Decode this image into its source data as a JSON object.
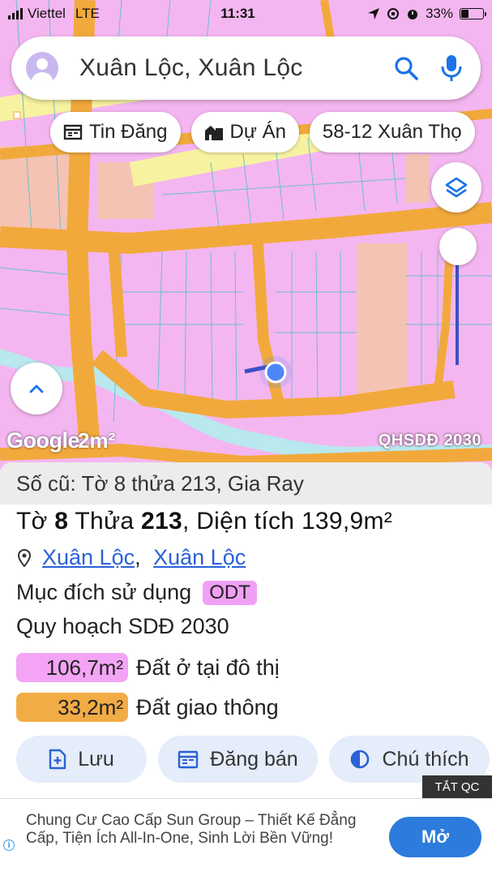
{
  "status_bar": {
    "carrier": "Viettel",
    "network": "LTE",
    "time": "11:31",
    "battery": "33%",
    "battery_level": 0.33
  },
  "search": {
    "query": "Xuân Lộc, Xuân Lộc"
  },
  "chips": [
    {
      "label": "Tin Đăng",
      "icon": "news-icon"
    },
    {
      "label": "Dự Án",
      "icon": "building-icon"
    },
    {
      "label": "58-12 Xuân Thọ",
      "icon": ""
    }
  ],
  "map": {
    "google_logo": "Google",
    "scale_text": "2m²",
    "layer_label": "QHSDĐ 2030",
    "colors": {
      "residential": "#f4b6f0",
      "road": "#f2a93c",
      "water": "#b9e8ee",
      "agri": "#f5c3b3",
      "yellow_road": "#f7f2a0",
      "parcel_line": "#5bbfd2",
      "marker": "#4f86f7"
    }
  },
  "sheet": {
    "old_info": "Số cũ: Tờ 8 thửa 213, Gia Ray",
    "title_prefix": "Tờ",
    "sheet_no": "8",
    "parcel_prefix": "Thửa",
    "parcel_no": "213",
    "area_prefix": ", Diện tích",
    "area_value": "139,9m²",
    "location_1": "Xuân Lộc",
    "location_sep": ",",
    "location_2": "Xuân Lộc",
    "purpose_label": "Mục đích sử dụng",
    "purpose_code": "ODT",
    "plan_label": "Quy hoạch SDĐ 2030",
    "areas": [
      {
        "value": "106,7m²",
        "label": "Đất ở tại đô thị",
        "color": "#f3a4f5"
      },
      {
        "value": "33,2m²",
        "label": "Đất giao thông",
        "color": "#f2ac45"
      }
    ],
    "actions": [
      {
        "label": "Lưu",
        "icon": "bookmark-add-icon"
      },
      {
        "label": "Đăng bán",
        "icon": "calendar-icon"
      },
      {
        "label": "Chú thích",
        "icon": "contrast-icon"
      }
    ]
  },
  "ad": {
    "tag": "TẮT QC",
    "text": "Chung Cư Cao Cấp Sun Group – Thiết Kế Đẳng Cấp, Tiện Ích All-In-One, Sinh Lời Bền Vững!",
    "cta": "Mở"
  }
}
